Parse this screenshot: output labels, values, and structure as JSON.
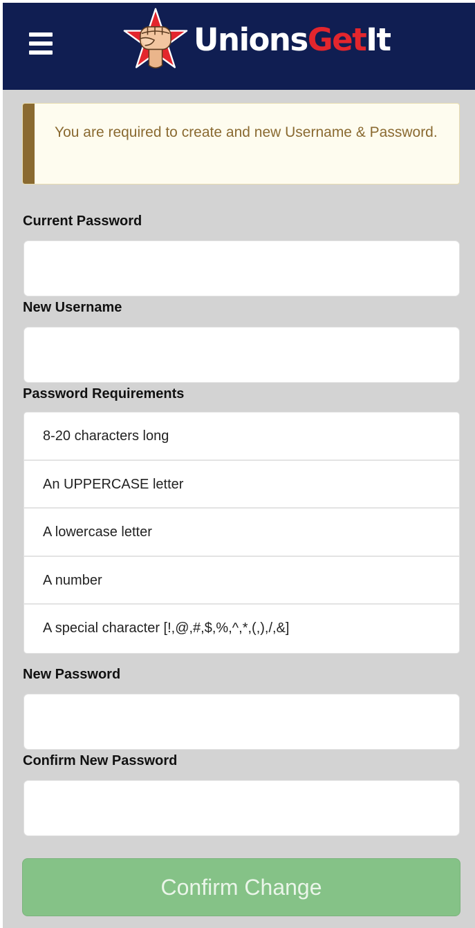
{
  "header": {
    "menu_icon": "hamburger-menu-icon",
    "logo_icon": "fist-star-icon",
    "brand_part1": "Unions",
    "brand_part2": "Get",
    "brand_part3": "It",
    "colors": {
      "navy": "#101e52",
      "brand_red": "#e3262d",
      "white": "#ffffff"
    }
  },
  "alert": {
    "message": "You are required to create and new Username & Password.",
    "bar_color": "#8a6a31",
    "background": "#fefcef"
  },
  "form": {
    "current_password_label": "Current Password",
    "current_password_value": "",
    "new_username_label": "New Username",
    "new_username_value": "",
    "requirements_label": "Password Requirements",
    "requirements": [
      "8-20 characters long",
      "An UPPERCASE letter",
      "A lowercase letter",
      "A number",
      "A special character [!,@,#,$,%,^,*,(,),/,&]"
    ],
    "new_password_label": "New Password",
    "new_password_value": "",
    "confirm_password_label": "Confirm New Password",
    "confirm_password_value": "",
    "submit_label": "Confirm Change",
    "submit_color": "#85c287"
  }
}
